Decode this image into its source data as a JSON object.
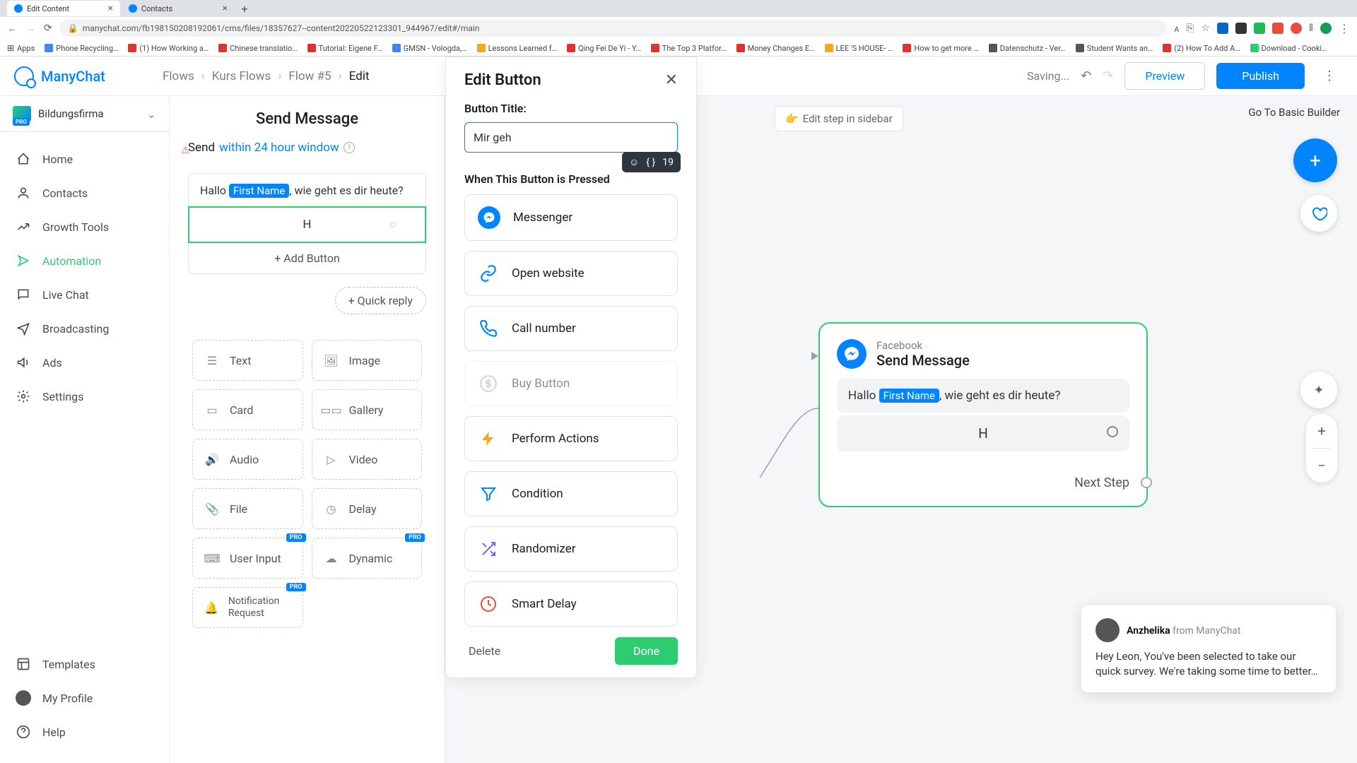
{
  "browser": {
    "tabs": [
      {
        "title": "Edit Content",
        "active": true
      },
      {
        "title": "Contacts",
        "active": false
      }
    ],
    "url": "manychat.com/fb198150208192061/cms/files/18357627--content20220522123301_944967/edit#/main",
    "bookmarks": [
      "Apps",
      "Phone Recycling…",
      "(1) How Working a…",
      "Chinese translatio…",
      "Tutorial: Eigene F…",
      "GMSN - Vologda,…",
      "Lessons Learned f…",
      "Qing Fei De Yi - Y…",
      "The Top 3 Platfor…",
      "Money Changes E…",
      "LEE 'S HOUSE- …",
      "How to get more …",
      "Datenschutz - Ver…",
      "Student Wants an…",
      "(2) How To Add A…",
      "Download - Cooki…"
    ]
  },
  "header": {
    "logo": "ManyChat",
    "breadcrumb": [
      "Flows",
      "Kurs Flows",
      "Flow #5",
      "Edit"
    ],
    "saving": "Saving...",
    "preview": "Preview",
    "publish": "Publish"
  },
  "sidebar": {
    "account": {
      "name": "Bildungsfirma",
      "badge": "PRO"
    },
    "nav": [
      {
        "label": "Home",
        "icon": "home"
      },
      {
        "label": "Contacts",
        "icon": "contacts"
      },
      {
        "label": "Growth Tools",
        "icon": "growth"
      },
      {
        "label": "Automation",
        "icon": "automation",
        "active": true
      },
      {
        "label": "Live Chat",
        "icon": "chat"
      },
      {
        "label": "Broadcasting",
        "icon": "broadcast"
      },
      {
        "label": "Ads",
        "icon": "ads"
      },
      {
        "label": "Settings",
        "icon": "settings"
      }
    ],
    "bottom": [
      {
        "label": "Templates",
        "icon": "templates"
      },
      {
        "label": "My Profile",
        "icon": "profile"
      },
      {
        "label": "Help",
        "icon": "help"
      }
    ]
  },
  "mid": {
    "title": "Send Message",
    "send_prefix": "Send",
    "send_link": "within 24 hour window",
    "msg_prefix": "Hallo ",
    "msg_var": "First Name",
    "msg_suffix": ", wie geht es dir heute?",
    "button_h": "H",
    "add_button": "+ Add Button",
    "quick_reply": "+ Quick reply",
    "attachments": [
      {
        "label": "Text",
        "icon": "text"
      },
      {
        "label": "Image",
        "icon": "image"
      },
      {
        "label": "Card",
        "icon": "card"
      },
      {
        "label": "Gallery",
        "icon": "gallery"
      },
      {
        "label": "Audio",
        "icon": "audio"
      },
      {
        "label": "Video",
        "icon": "video"
      },
      {
        "label": "File",
        "icon": "file"
      },
      {
        "label": "Delay",
        "icon": "delay"
      },
      {
        "label": "User Input",
        "icon": "input",
        "pro": true
      },
      {
        "label": "Dynamic",
        "icon": "dynamic",
        "pro": true
      },
      {
        "label": "Notification Request",
        "icon": "bell",
        "pro": true
      }
    ]
  },
  "edit_panel": {
    "title": "Edit Button",
    "label_title": "Button Title:",
    "input_value": "Mir geh",
    "char_count": "19",
    "sublabel": "When This Button is Pressed",
    "actions": [
      {
        "label": "Messenger",
        "icon": "messenger",
        "color": "#0084ff"
      },
      {
        "label": "Open website",
        "icon": "link",
        "color": "#0084ff"
      },
      {
        "label": "Call number",
        "icon": "phone",
        "color": "#0084ff"
      },
      {
        "label": "Buy Button",
        "icon": "dollar",
        "color": "#a8afb8",
        "disabled": true
      },
      {
        "label": "Perform Actions",
        "icon": "bolt",
        "color": "#f5a623"
      },
      {
        "label": "Condition",
        "icon": "filter",
        "color": "#0084ff"
      },
      {
        "label": "Randomizer",
        "icon": "shuffle",
        "color": "#7b61ff"
      },
      {
        "label": "Smart Delay",
        "icon": "clock",
        "color": "#e74c3c"
      }
    ],
    "delete": "Delete",
    "done": "Done"
  },
  "canvas": {
    "edit_step": "Edit step in sidebar",
    "basic_builder": "Go To Basic Builder",
    "node": {
      "platform": "Facebook",
      "title": "Send Message",
      "msg_prefix": "Hallo ",
      "msg_var": "First Name",
      "msg_suffix": ", wie geht es dir heute?",
      "button_h": "H",
      "next_step": "Next Step"
    }
  },
  "support": {
    "name": "Anzhelika",
    "from": " from ManyChat",
    "body": "Hey Leon,  You've been selected to take our quick survey. We're taking some time to better…"
  }
}
